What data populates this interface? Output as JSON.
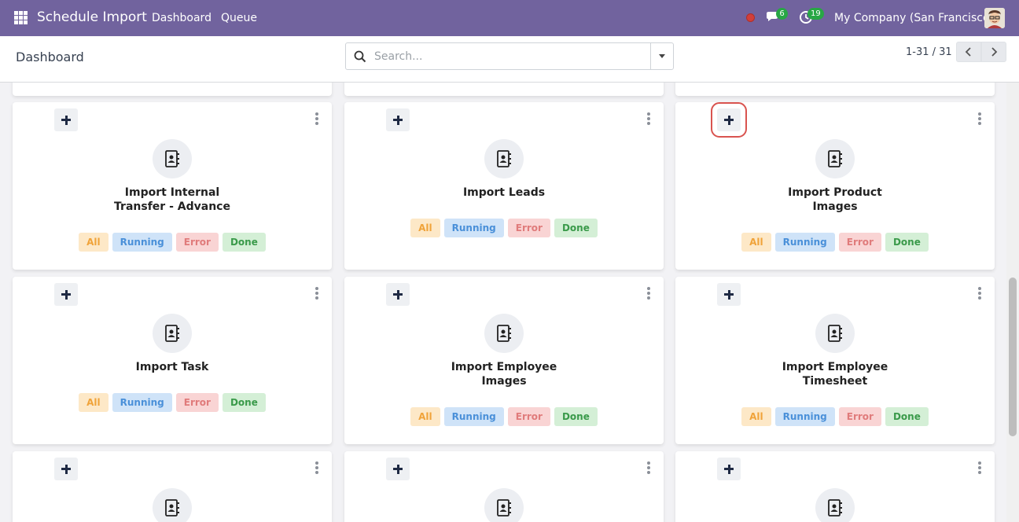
{
  "navbar": {
    "app_name": "Schedule Import",
    "menu": [
      "Dashboard",
      "Queue"
    ],
    "message_count": "6",
    "activity_count": "19",
    "company": "My Company (San Francisco)",
    "icons": [
      "apps-grid-icon",
      "recording-dot-icon",
      "chat-icon",
      "clock-icon",
      "user-avatar"
    ]
  },
  "control_panel": {
    "breadcrumb": "Dashboard",
    "search_placeholder": "Search...",
    "pager": "1-31 / 31"
  },
  "tag_labels": [
    "All",
    "Running",
    "Error",
    "Done"
  ],
  "cards": [
    {
      "title": "Import Internal Transfer - Advance",
      "title_lines": [
        "Import Internal",
        "Transfer - Advance"
      ]
    },
    {
      "title": "Import Leads",
      "title_lines": [
        "Import Leads"
      ]
    },
    {
      "title": "Import Product Images",
      "title_lines": [
        "Import Product",
        "Images"
      ]
    },
    {
      "title": "Import Task",
      "title_lines": [
        "Import Task"
      ]
    },
    {
      "title": "Import Employee Images",
      "title_lines": [
        "Import Employee",
        "Images"
      ]
    },
    {
      "title": "Import Employee Timesheet",
      "title_lines": [
        "Import Employee",
        "Timesheet"
      ]
    }
  ],
  "colors": {
    "navbar": "#71639e",
    "tag_all_bg": "#fde8c7",
    "tag_running_bg": "#cfe3f8",
    "tag_error_bg": "#f9d4d4",
    "tag_done_bg": "#d4efd6",
    "highlight": "#d9534f"
  }
}
